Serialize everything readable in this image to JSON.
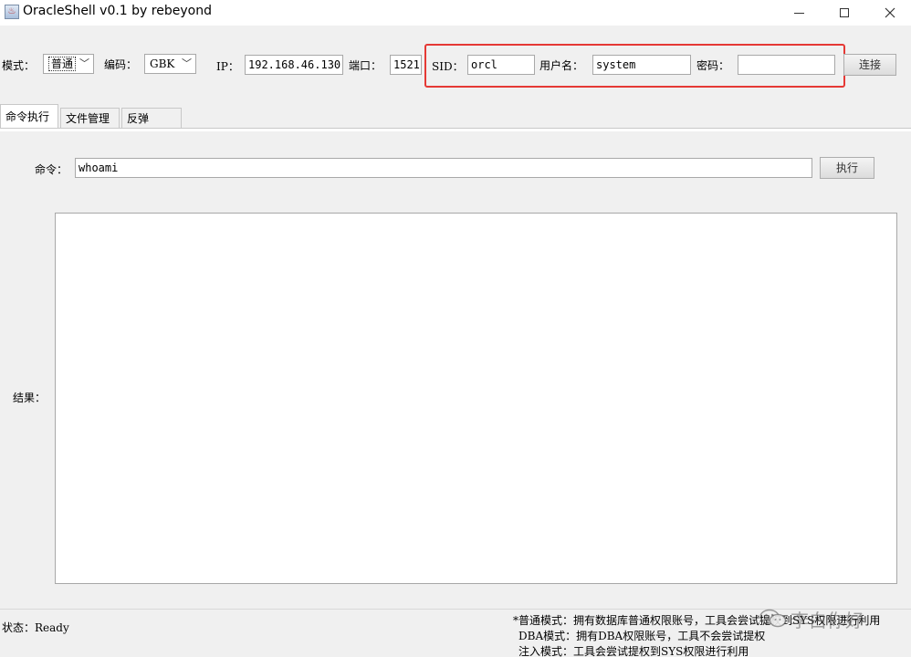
{
  "window": {
    "title": "OracleShell v0.1  by rebeyond",
    "app_icon_glyph": "♨"
  },
  "toolbar": {
    "mode_label": "模式：",
    "mode_value": "普通",
    "encoding_label": "编码：",
    "encoding_value": "GBK",
    "ip_label": "IP：",
    "ip_value": "192.168.46.130",
    "port_label": "端口：",
    "port_value": "1521",
    "sid_label": "SID：",
    "sid_value": "orcl",
    "username_label": "用户名：",
    "username_value": "system",
    "password_label": "密码：",
    "password_value": "",
    "connect_label": "连接"
  },
  "tabs": [
    {
      "label": "命令执行",
      "active": true
    },
    {
      "label": "文件管理",
      "active": false
    },
    {
      "label": "反弹Shell",
      "active": false
    }
  ],
  "command": {
    "label": "命令：",
    "value": "whoami",
    "execute_label": "执行"
  },
  "result": {
    "label": "结果：",
    "value": ""
  },
  "status": {
    "text": "状态：Ready",
    "notes": [
      "*普通模式：拥有数据库普通权限账号，工具会尝试提权到SYS权限进行利用",
      "DBA模式：拥有DBA权限账号，工具不会尝试提权",
      "注入模式：工具会尝试提权到SYS权限进行利用"
    ]
  },
  "watermark": {
    "text": "李白你好",
    "icon": "wechat-icon"
  },
  "colors": {
    "highlight": "#e53935",
    "window_bg": "#f0f0f0"
  }
}
